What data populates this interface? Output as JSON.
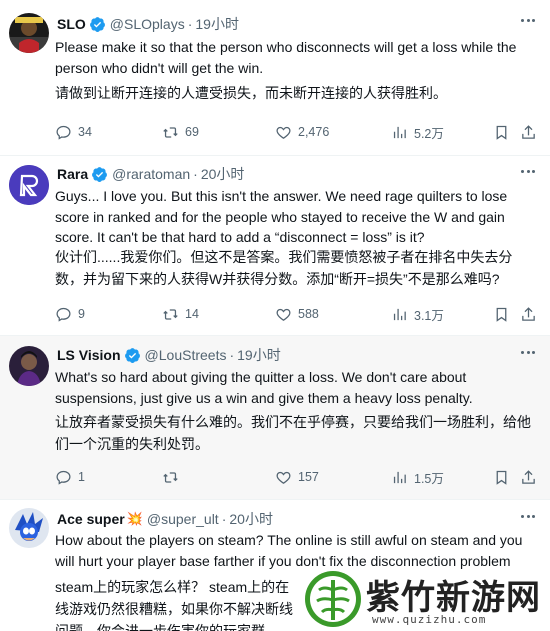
{
  "tweets": [
    {
      "name": "SLO",
      "badge": "",
      "handle": "@SLOplays",
      "time": "19小时",
      "text": [
        "Please make it so that the person who disconnects will get a loss while the person who didn't will get the win."
      ],
      "translation": "请做到让断开连接的人遭受损失，而未断开连接的人获得胜利。",
      "replies": "34",
      "reposts": "69",
      "likes": "2,476",
      "views": "5.2万"
    },
    {
      "name": "Rara",
      "badge": "",
      "handle": "@raratoman",
      "time": "20小时",
      "text": [
        "Guys... I love you. But this isn't the answer. We need rage quilters to lose score in ranked and for the people who stayed to receive the W and gain score. It can't be that hard to add a “disconnect = loss” is it?"
      ],
      "translation": "伙计们......我爱你们。但这不是答案。我们需要愤怒被子者在排名中失去分数，并为留下来的人获得W并获得分数。添加“断开=损失”不是那么难吗?",
      "replies": "9",
      "reposts": "14",
      "likes": "588",
      "views": "3.1万"
    },
    {
      "name": "LS Vision",
      "badge": "",
      "handle": "@LouStreets",
      "time": "19小时",
      "text": [
        "What's so hard about giving the quitter a loss. We don't care about suspensions, just give us a win and give them a heavy loss penalty."
      ],
      "translation": "让放弃者蒙受损失有什么难的。我们不在乎停赛，只要给我们一场胜利，给他们一个沉重的失利处罚。",
      "replies": "1",
      "reposts": "",
      "likes": "157",
      "views": "1.5万"
    },
    {
      "name": "Ace super",
      "badge": "💥",
      "handle": "@super_ult",
      "time": "20小时",
      "text": [
        "How about the players on steam? The online is still awful on steam and you will hurt your player base farther if you don't fix the disconnection problem"
      ],
      "translation": "steam上的玩家怎么样？ steam上的在线游戏仍然很糟糕，如果你不解决断线问题，你会进一步伤害你的玩家群",
      "replies": "",
      "reposts": "",
      "likes": "",
      "views": ""
    }
  ],
  "watermark": {
    "name": "紫竹新游网",
    "url": "www.quzizhu.com"
  },
  "colors": {
    "verified": "#1d9bf0",
    "secondary_text": "#536471",
    "highlight_bg": "#f7f7f7",
    "watermark_green": "#3a9a2a"
  }
}
